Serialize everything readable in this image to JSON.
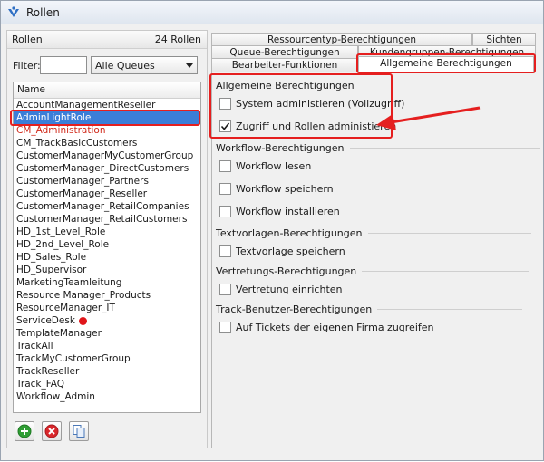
{
  "window": {
    "title": "Rollen"
  },
  "left": {
    "header_title": "Rollen",
    "role_count": "24 Rollen",
    "filter_label": "Filter:",
    "filter_value": "",
    "queue_select": "Alle Queues",
    "column_header": "Name",
    "roles": [
      {
        "name": "AccountManagementReseller"
      },
      {
        "name": "AdminLightRole"
      },
      {
        "name": "CM_Administration"
      },
      {
        "name": "CM_TrackBasicCustomers"
      },
      {
        "name": "CustomerManagerMyCustomerGroup"
      },
      {
        "name": "CustomerManager_DirectCustomers"
      },
      {
        "name": "CustomerManager_Partners"
      },
      {
        "name": "CustomerManager_Reseller"
      },
      {
        "name": "CustomerManager_RetailCompanies"
      },
      {
        "name": "CustomerManager_RetailCustomers"
      },
      {
        "name": "HD_1st_Level_Role"
      },
      {
        "name": "HD_2nd_Level_Role"
      },
      {
        "name": "HD_Sales_Role"
      },
      {
        "name": "HD_Supervisor"
      },
      {
        "name": "MarketingTeamleitung"
      },
      {
        "name": "Resource Manager_Products"
      },
      {
        "name": "ResourceManager_IT"
      },
      {
        "name": "ServiceDesk"
      },
      {
        "name": "TemplateManager"
      },
      {
        "name": "TrackAll"
      },
      {
        "name": "TrackMyCustomerGroup"
      },
      {
        "name": "TrackReseller"
      },
      {
        "name": "Track_FAQ"
      },
      {
        "name": "Workflow_Admin"
      }
    ],
    "selected_index": 1,
    "buttons": [
      "add-icon",
      "delete-icon",
      "copy-icon"
    ]
  },
  "tabs": {
    "row1": [
      "Ressourcentyp-Berechtigungen",
      "Sichten"
    ],
    "row2": [
      "Queue-Berechtigungen",
      "Kundengruppen-Berechtigungen"
    ],
    "row3": [
      "Bearbeiter-Funktionen",
      "Allgemeine Berechtigungen"
    ],
    "active": "Allgemeine Berechtigungen"
  },
  "groups": [
    {
      "title": "Allgemeine Berechtigungen",
      "items": [
        {
          "label": "System administieren (Vollzugriff)",
          "checked": false
        },
        {
          "label": "Zugriff und Rollen administieren",
          "checked": true
        }
      ]
    },
    {
      "title": "Workflow-Berechtigungen",
      "items": [
        {
          "label": "Workflow lesen",
          "checked": false
        },
        {
          "label": "Workflow speichern",
          "checked": false
        },
        {
          "label": "Workflow installieren",
          "checked": false
        }
      ]
    },
    {
      "title": "Textvorlagen-Berechtigungen",
      "items": [
        {
          "label": "Textvorlage speichern",
          "checked": false
        }
      ]
    },
    {
      "title": "Vertretungs-Berechtigungen",
      "items": [
        {
          "label": "Vertretung einrichten",
          "checked": false
        }
      ]
    },
    {
      "title": "Track-Benutzer-Berechtigungen",
      "items": [
        {
          "label": "Auf Tickets der eigenen Firma zugreifen",
          "checked": false
        }
      ]
    }
  ],
  "colors": {
    "selection": "#3b7ed8",
    "highlight": "#e51f1f",
    "red_text": "#d12a1a"
  }
}
